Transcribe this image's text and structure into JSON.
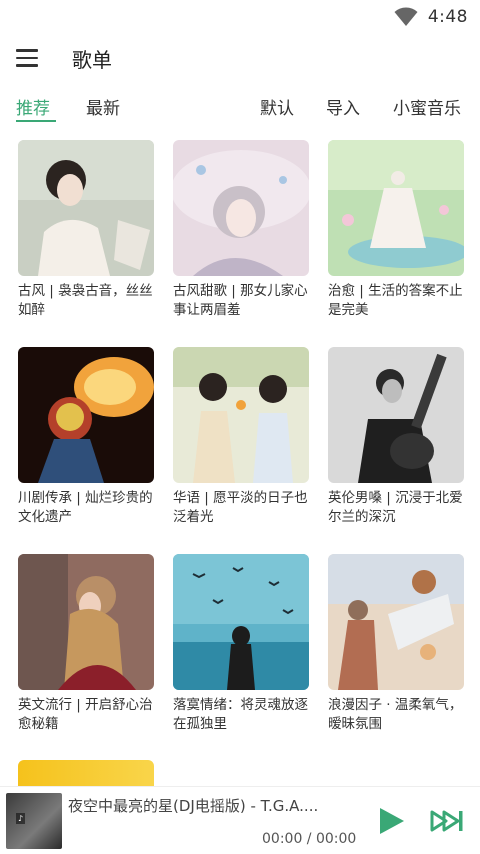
{
  "status_bar": {
    "time": "4:48"
  },
  "app_bar": {
    "title": "歌单"
  },
  "tabs": {
    "left": [
      "推荐",
      "最新"
    ],
    "right": [
      "默认",
      "导入",
      "小蜜音乐"
    ]
  },
  "playlists": [
    {
      "caption": "古风 | 袅袅古音，丝丝如醉"
    },
    {
      "caption": "古风甜歌 | 那女儿家心事让两眉羞"
    },
    {
      "caption": "治愈 | 生活的答案不止是完美"
    },
    {
      "caption": "川剧传承 | 灿烂珍贵的文化遗产"
    },
    {
      "caption": "华语 | 愿平淡的日子也泛着光"
    },
    {
      "caption": "英伦男嗓 | 沉浸于北爱尔兰的深沉"
    },
    {
      "caption": "英文流行 | 开启舒心治愈秘籍"
    },
    {
      "caption": "落寞情绪：将灵魂放逐在孤独里"
    },
    {
      "caption": "浪漫因子 · 温柔氧气，暧昧氛围"
    }
  ],
  "player": {
    "title": "夜空中最亮的星(DJ电摇版) - T.G.A....",
    "time": "00:00 / 00:00"
  },
  "colors": {
    "accent": "#3aa876"
  }
}
